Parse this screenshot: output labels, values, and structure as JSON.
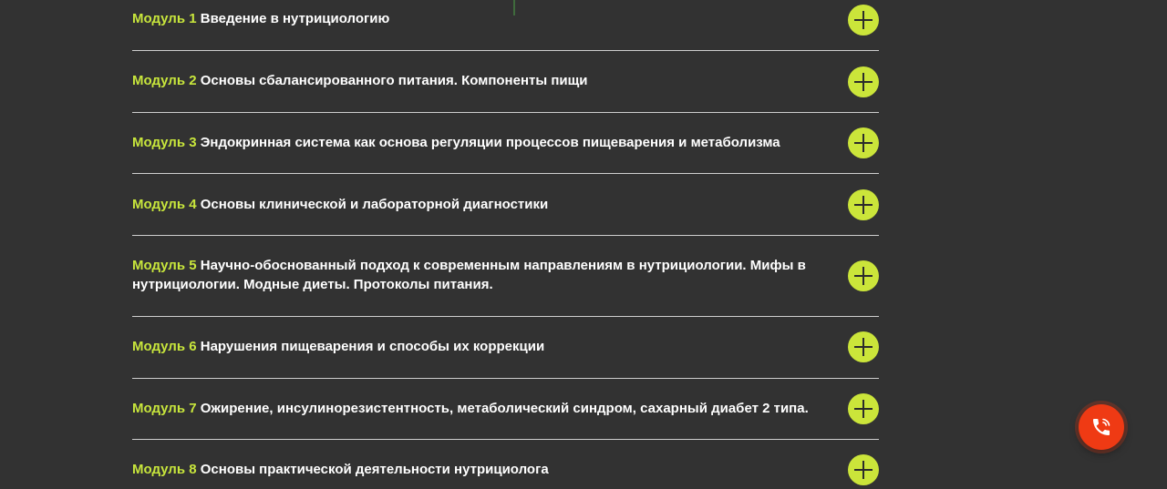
{
  "accordion": {
    "modules": [
      {
        "num": "Модуль 1",
        "title": "Введение в нутрициологию"
      },
      {
        "num": "Модуль 2",
        "title": "Основы сбалансированного питания. Компоненты пищи"
      },
      {
        "num": "Модуль 3",
        "title": "Эндокринная система как основа регуляции процессов пищеварения и метаболизма"
      },
      {
        "num": "Модуль 4",
        "title": "Основы клинической и лабораторной диагностики"
      },
      {
        "num": "Модуль 5",
        "title": "Научно-обоснованный подход к современным направлениям в нутрициологии. Мифы в нутрициологии. Модные диеты. Протоколы питания."
      },
      {
        "num": "Модуль 6",
        "title": "Нарушения пищеварения и способы их коррекции"
      },
      {
        "num": "Модуль 7",
        "title": "Ожирение, инсулинорезистентность, метаболический синдром, сахарный диабет 2 типа."
      },
      {
        "num": "Модуль 8",
        "title": "Основы практической деятельности нутрициолога"
      }
    ],
    "toggle_icon": "plus-icon"
  },
  "call_button": {
    "icon": "phone-icon"
  },
  "colors": {
    "background": "#323232",
    "accent": "#cbe53a",
    "module_label": "#c8e63c",
    "call_button": "#ef3a14"
  }
}
